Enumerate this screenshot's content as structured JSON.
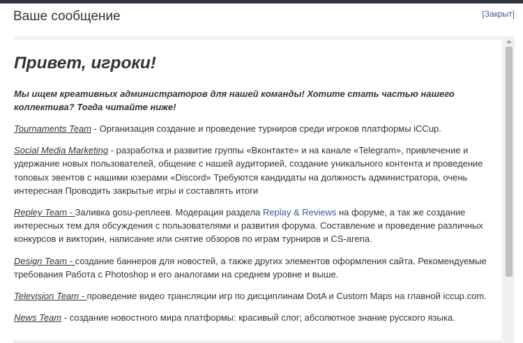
{
  "dialog": {
    "title": "Ваше сообщение",
    "close_label": "[Закрыт]"
  },
  "message": {
    "heading": "Привет, игроки!",
    "lead": "Мы ищем креативных администраторов для нашей команды! Хотите стать частью нашего коллектива? Тогда читайте ниже!",
    "sections": [
      {
        "team": "Tournaments Team",
        "text": " - Организация создание и проведение турниров среди игроков платформы iCCup."
      },
      {
        "team": "Social Media Marketing",
        "text": " - разработка и развитие группы «Вконтакте» и на канале «Telegram», привлечение и удержание новых пользователей, общение с нашей аудиторией, создание уникального контента и проведение топовых эвентов с нашими юзерами «Discord» Требуются кандидаты на должность администратора, очень интересная Проводить закрытые игры и составлять итоги"
      },
      {
        "team": "Repley Team - ",
        "text_before": "Заливка gosu-реплеев. Модерация раздела ",
        "link": "Replay & Reviews",
        "text_after": " на форуме, а так же создание интересных тем для обсуждения с пользователями и развития форума. Составление и проведение различных конкурсов и викторин, написание или снятие обзоров по играм турниров и CS-arena."
      },
      {
        "team": "Design Team - ",
        "text": "создание баннеров для новостей, а также других элементов оформления сайта. Рекомендуемые требования Работа с Photoshop и его аналогами на среднем уровне и выше."
      },
      {
        "team": "Television Team - ",
        "text": "проведение видео трансляции игр по дисциплинам DotA и Custom Maps на главной iccup.com."
      },
      {
        "team": "News Team",
        "text": " - создание новостного мира платформы: красивый слог; абсолютное знание русского языка."
      }
    ]
  }
}
